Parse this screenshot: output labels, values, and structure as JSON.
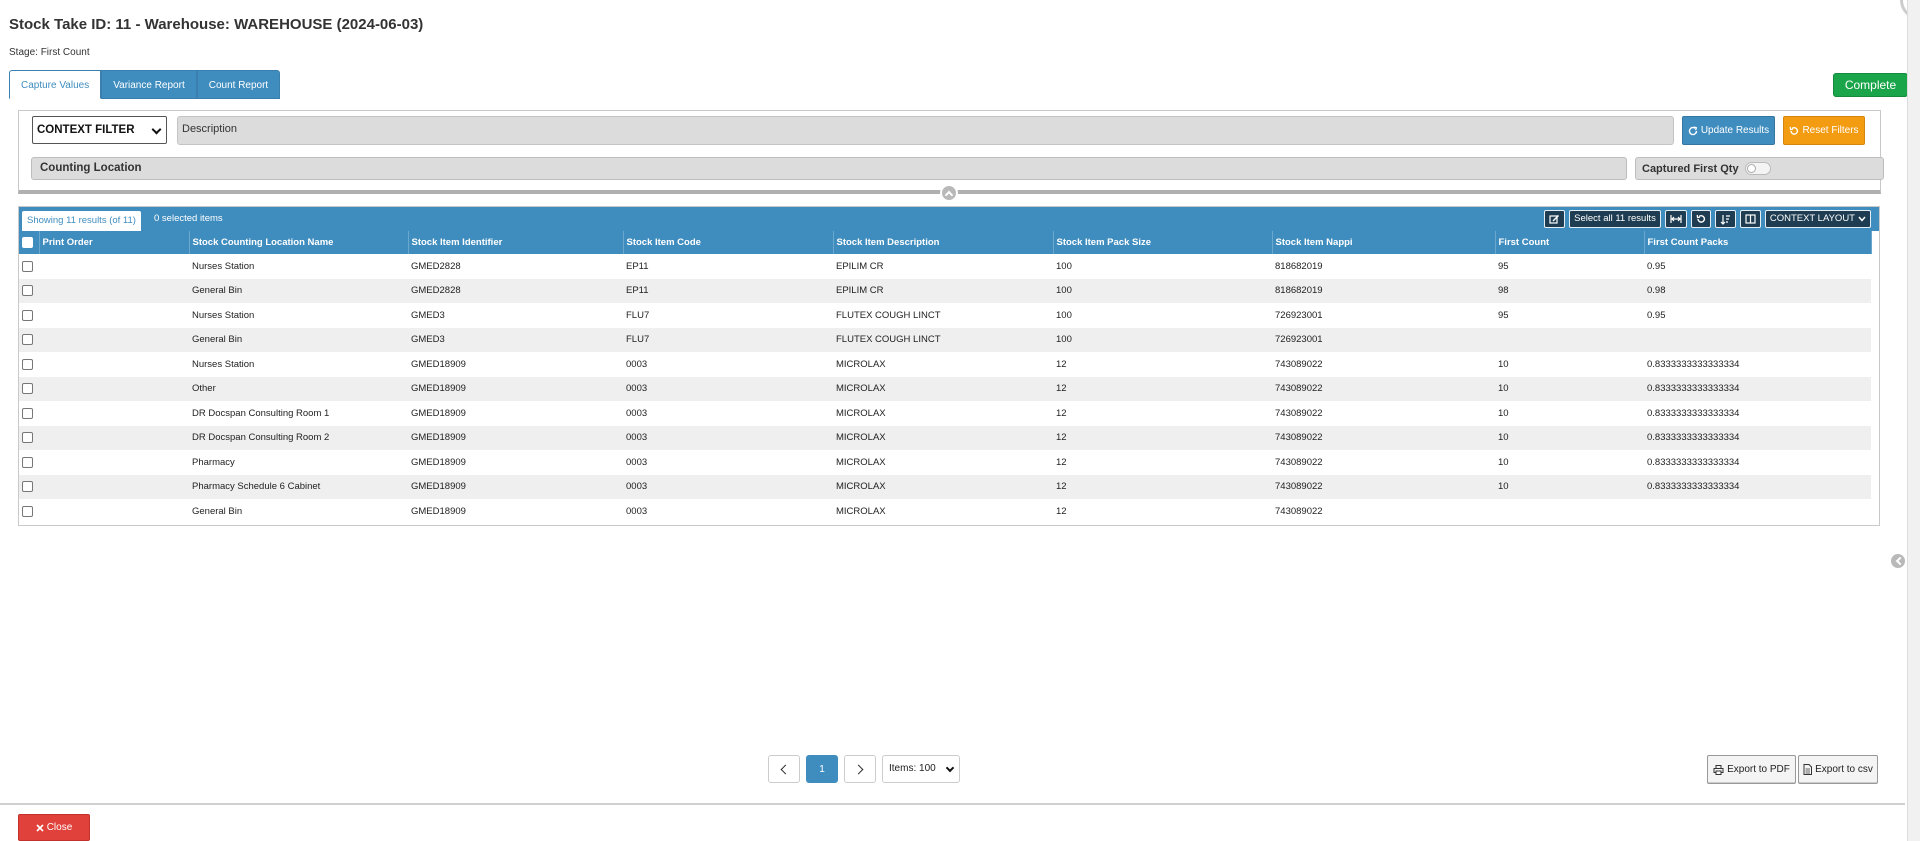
{
  "header": {
    "title": "Stock Take ID: 11 - Warehouse: WAREHOUSE (2024-06-03)",
    "stage": "Stage: First Count"
  },
  "tabs": [
    {
      "label": "Capture Values",
      "active": true
    },
    {
      "label": "Variance Report",
      "active": false
    },
    {
      "label": "Count Report",
      "active": false
    }
  ],
  "complete_label": "Complete",
  "filters": {
    "context_filter": "CONTEXT FILTER",
    "description_label": "Description",
    "update_label": "Update Results",
    "reset_label": "Reset Filters",
    "counting_location_label": "Counting Location",
    "captured_first_qty_label": "Captured First Qty",
    "captured_first_qty_on": false
  },
  "grid": {
    "showing": "Showing 11 results (of 11)",
    "selected": "0 selected items",
    "select_all_label": "Select all 11 results",
    "context_layout_label": "CONTEXT LAYOUT",
    "columns": [
      "Print Order",
      "Stock Counting Location Name",
      "Stock Item Identifier",
      "Stock Item Code",
      "Stock Item Description",
      "Stock Item Pack Size",
      "Stock Item Nappi",
      "First Count",
      "First Count Packs"
    ],
    "rows": [
      [
        "",
        "Nurses Station",
        "GMED2828",
        "EP11",
        "EPILIM CR",
        "100",
        "818682019",
        "95",
        "0.95"
      ],
      [
        "",
        "General Bin",
        "GMED2828",
        "EP11",
        "EPILIM CR",
        "100",
        "818682019",
        "98",
        "0.98"
      ],
      [
        "",
        "Nurses Station",
        "GMED3",
        "FLU7",
        "FLUTEX COUGH LINCT",
        "100",
        "726923001",
        "95",
        "0.95"
      ],
      [
        "",
        "General Bin",
        "GMED3",
        "FLU7",
        "FLUTEX COUGH LINCT",
        "100",
        "726923001",
        "",
        ""
      ],
      [
        "",
        "Nurses Station",
        "GMED18909",
        "0003",
        "MICROLAX",
        "12",
        "743089022",
        "10",
        "0.8333333333333334"
      ],
      [
        "",
        "Other",
        "GMED18909",
        "0003",
        "MICROLAX",
        "12",
        "743089022",
        "10",
        "0.8333333333333334"
      ],
      [
        "",
        "DR Docspan Consulting Room 1",
        "GMED18909",
        "0003",
        "MICROLAX",
        "12",
        "743089022",
        "10",
        "0.8333333333333334"
      ],
      [
        "",
        "DR Docspan Consulting Room 2",
        "GMED18909",
        "0003",
        "MICROLAX",
        "12",
        "743089022",
        "10",
        "0.8333333333333334"
      ],
      [
        "",
        "Pharmacy",
        "GMED18909",
        "0003",
        "MICROLAX",
        "12",
        "743089022",
        "10",
        "0.8333333333333334"
      ],
      [
        "",
        "Pharmacy Schedule 6 Cabinet",
        "GMED18909",
        "0003",
        "MICROLAX",
        "12",
        "743089022",
        "10",
        "0.8333333333333334"
      ],
      [
        "",
        "General Bin",
        "GMED18909",
        "0003",
        "MICROLAX",
        "12",
        "743089022",
        "",
        ""
      ]
    ]
  },
  "pagination": {
    "current_page": "1",
    "items_label": "Items: 100"
  },
  "export": {
    "pdf_label": "Export to PDF",
    "csv_label": "Export to csv"
  },
  "close_label": "Close",
  "colors": {
    "primary": "#3f8dbf",
    "success": "#1aa54a",
    "warning": "#f39c12",
    "danger": "#e0423b"
  }
}
